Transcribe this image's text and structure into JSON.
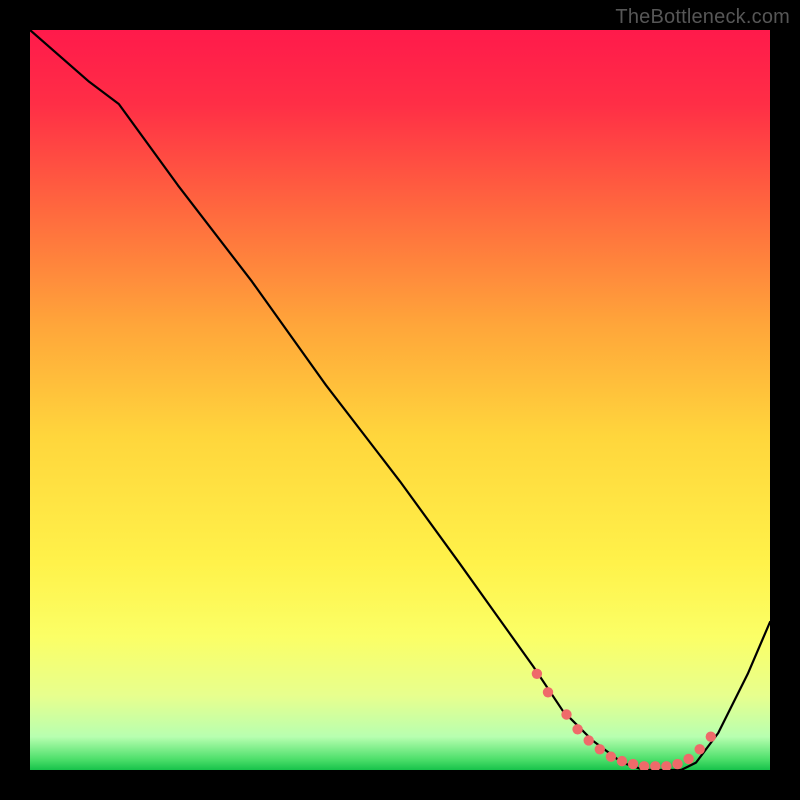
{
  "watermark": "TheBottleneck.com",
  "chart_data": {
    "type": "line",
    "title": "",
    "xlabel": "",
    "ylabel": "",
    "xlim": [
      0,
      100
    ],
    "ylim": [
      0,
      100
    ],
    "grid": false,
    "legend": false,
    "gradient_stops": [
      {
        "offset": 0.0,
        "color": "#ff1a4b"
      },
      {
        "offset": 0.1,
        "color": "#ff2e46"
      },
      {
        "offset": 0.25,
        "color": "#ff6b3e"
      },
      {
        "offset": 0.4,
        "color": "#ffa63a"
      },
      {
        "offset": 0.55,
        "color": "#ffd63c"
      },
      {
        "offset": 0.72,
        "color": "#fff24a"
      },
      {
        "offset": 0.82,
        "color": "#fbff66"
      },
      {
        "offset": 0.9,
        "color": "#e7ff8e"
      },
      {
        "offset": 0.955,
        "color": "#b8ffb0"
      },
      {
        "offset": 0.985,
        "color": "#4fe06c"
      },
      {
        "offset": 1.0,
        "color": "#17c24a"
      }
    ],
    "series": [
      {
        "name": "bottleneck-curve",
        "x": [
          0,
          8,
          12,
          20,
          30,
          40,
          50,
          58,
          63,
          68,
          72,
          76,
          80,
          83,
          86,
          88,
          90,
          93,
          97,
          100
        ],
        "y": [
          100,
          93,
          90,
          79,
          66,
          52,
          39,
          28,
          21,
          14,
          8,
          4,
          1,
          0,
          0,
          0,
          1,
          5,
          13,
          20
        ]
      }
    ],
    "markers": {
      "name": "highlight-dots",
      "x": [
        68.5,
        70.0,
        72.5,
        74.0,
        75.5,
        77.0,
        78.5,
        80.0,
        81.5,
        83.0,
        84.5,
        86.0,
        87.5,
        89.0,
        90.5,
        92.0
      ],
      "y": [
        13.0,
        10.5,
        7.5,
        5.5,
        4.0,
        2.8,
        1.8,
        1.2,
        0.8,
        0.5,
        0.5,
        0.5,
        0.8,
        1.5,
        2.8,
        4.5
      ]
    }
  }
}
